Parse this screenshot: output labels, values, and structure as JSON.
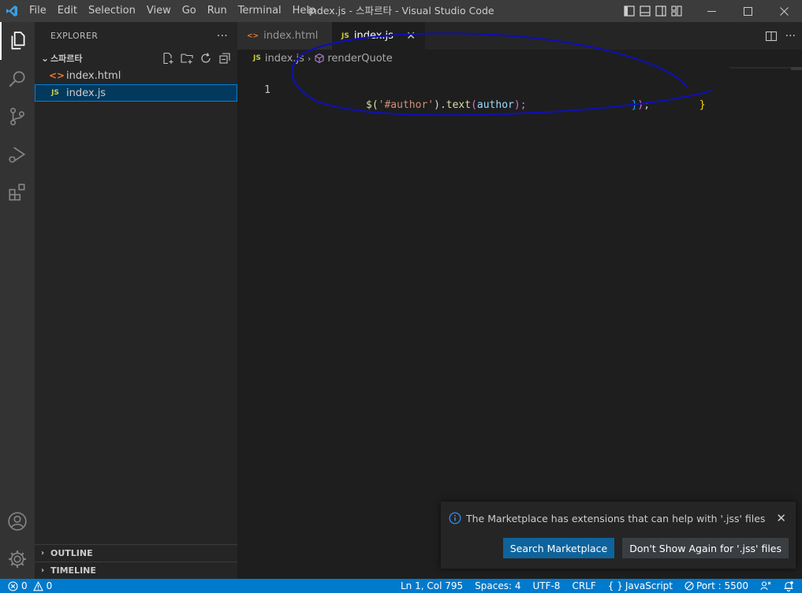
{
  "window": {
    "title": "index.js - 스파르타 - Visual Studio Code",
    "menu": [
      "File",
      "Edit",
      "Selection",
      "View",
      "Go",
      "Run",
      "Terminal",
      "Help"
    ]
  },
  "activity_bar": {
    "items": [
      "explorer-icon",
      "search-icon",
      "source-control-icon",
      "run-debug-icon",
      "extensions-icon"
    ],
    "bottom": [
      "account-icon",
      "manage-gear-icon"
    ]
  },
  "explorer": {
    "header": "EXPLORER",
    "more": "···",
    "folder": {
      "chevron": "⌄",
      "name": "스파르타"
    },
    "files": [
      {
        "icon": "<>",
        "name": "index.html"
      },
      {
        "icon": "JS",
        "name": "index.js"
      }
    ],
    "sections": [
      {
        "chevron": "›",
        "name": "OUTLINE"
      },
      {
        "chevron": "›",
        "name": "TIMELINE"
      }
    ]
  },
  "editor": {
    "tabs": [
      {
        "icon": "<>",
        "label": "index.html"
      },
      {
        "icon": "JS",
        "label": "index.js",
        "close": "✕"
      }
    ],
    "breadcrumbs": {
      "file_icon": "JS",
      "file": "index.js",
      "sep": "›",
      "symbol": "renderQuote"
    },
    "code": {
      "line_number": "1",
      "tokens": {
        "dollar": "$(",
        "string": "'#author'",
        "close_paren": ")",
        "dot": ".",
        "method": "text",
        "open": "(",
        "arg": "author",
        "end": ");",
        "gap": "                 ",
        "brace1": "}",
        "paren2": ")",
        "semi": ";",
        "gap2": "        ",
        "brace2": "}"
      }
    }
  },
  "notification": {
    "message": "The Marketplace has extensions that can help with '.jss' files",
    "close": "✕",
    "buttons": [
      "Search Marketplace",
      "Don't Show Again for '.jss' files"
    ]
  },
  "status_bar": {
    "errors": "0",
    "warnings": "0",
    "position": "Ln 1, Col 795",
    "spaces": "Spaces: 4",
    "encoding": "UTF-8",
    "eol": "CRLF",
    "language_icon": "{ }",
    "language": "JavaScript",
    "port": "Port : 5500"
  },
  "colors": {
    "accent": "#007acc",
    "selection": "#04395e",
    "annotation_ink": "#1010b0"
  }
}
